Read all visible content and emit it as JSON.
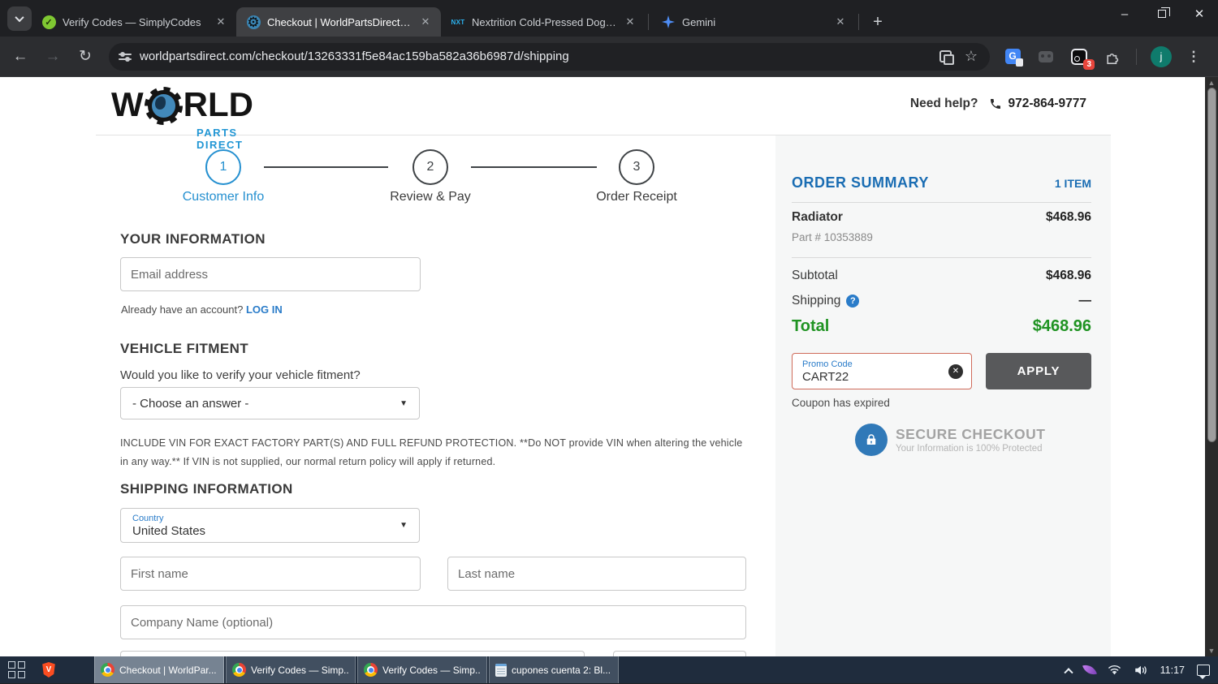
{
  "browser": {
    "tabs": [
      {
        "title": "Verify Codes — SimplyCodes"
      },
      {
        "title": "Checkout | WorldPartsDirect.co"
      },
      {
        "title": "Nextrition Cold-Pressed Dog Fo"
      },
      {
        "title": "Gemini"
      }
    ],
    "url": "worldpartsdirect.com/checkout/13263331f5e84ac159ba582a36b6987d/shipping",
    "extension_badge": "3",
    "profile_initial": "j"
  },
  "page": {
    "header": {
      "logo_main_left": "W",
      "logo_main_right": "RLD",
      "logo_sub": "PARTS DIRECT",
      "need_help": "Need help?",
      "phone": "972-864-9777"
    },
    "steps": [
      {
        "number": "1",
        "label": "Customer Info"
      },
      {
        "number": "2",
        "label": "Review & Pay"
      },
      {
        "number": "3",
        "label": "Order Receipt"
      }
    ],
    "your_info": {
      "heading": "YOUR INFORMATION",
      "email_placeholder": "Email address",
      "account_prompt": "Already have an account?",
      "login_link": "LOG IN"
    },
    "vehicle_fitment": {
      "heading": "VEHICLE FITMENT",
      "question": "Would you like to verify your vehicle fitment?",
      "select_value": "- Choose an answer -",
      "disclaimer": "INCLUDE VIN FOR EXACT FACTORY PART(S) AND FULL REFUND PROTECTION. **Do NOT provide VIN when altering the vehicle in any way.** If VIN is not supplied, our normal return policy will apply if returned."
    },
    "shipping_info": {
      "heading": "SHIPPING INFORMATION",
      "country_label": "Country",
      "country_value": "United States",
      "first_name_placeholder": "First name",
      "last_name_placeholder": "Last name",
      "company_placeholder": "Company Name (optional)"
    },
    "order_summary": {
      "heading": "ORDER SUMMARY",
      "item_count": "1 ITEM",
      "item_name": "Radiator",
      "item_price": "$468.96",
      "item_part": "Part # 10353889",
      "subtotal_label": "Subtotal",
      "subtotal_value": "$468.96",
      "shipping_label": "Shipping",
      "shipping_value": "—",
      "total_label": "Total",
      "total_value": "$468.96",
      "promo_label": "Promo Code",
      "promo_value": "CART22",
      "apply_label": "APPLY",
      "promo_error": "Coupon has expired",
      "secure_title": "SECURE CHECKOUT",
      "secure_subtitle": "Your Information is 100% Protected"
    }
  },
  "taskbar": {
    "items": [
      {
        "label": "Checkout | WorldPar..."
      },
      {
        "label": "Verify Codes — Simp..."
      },
      {
        "label": "Verify Codes — Simp..."
      },
      {
        "label": "cupones cuenta 2: Bl..."
      }
    ],
    "time": "11:17"
  },
  "colors": {
    "accent_blue": "#2a7cc9",
    "step_blue": "#2590d0",
    "summary_blue": "#1a6db3",
    "total_green": "#1f9322",
    "promo_error_border": "#cf6b5a",
    "apply_gray": "#58595b"
  }
}
